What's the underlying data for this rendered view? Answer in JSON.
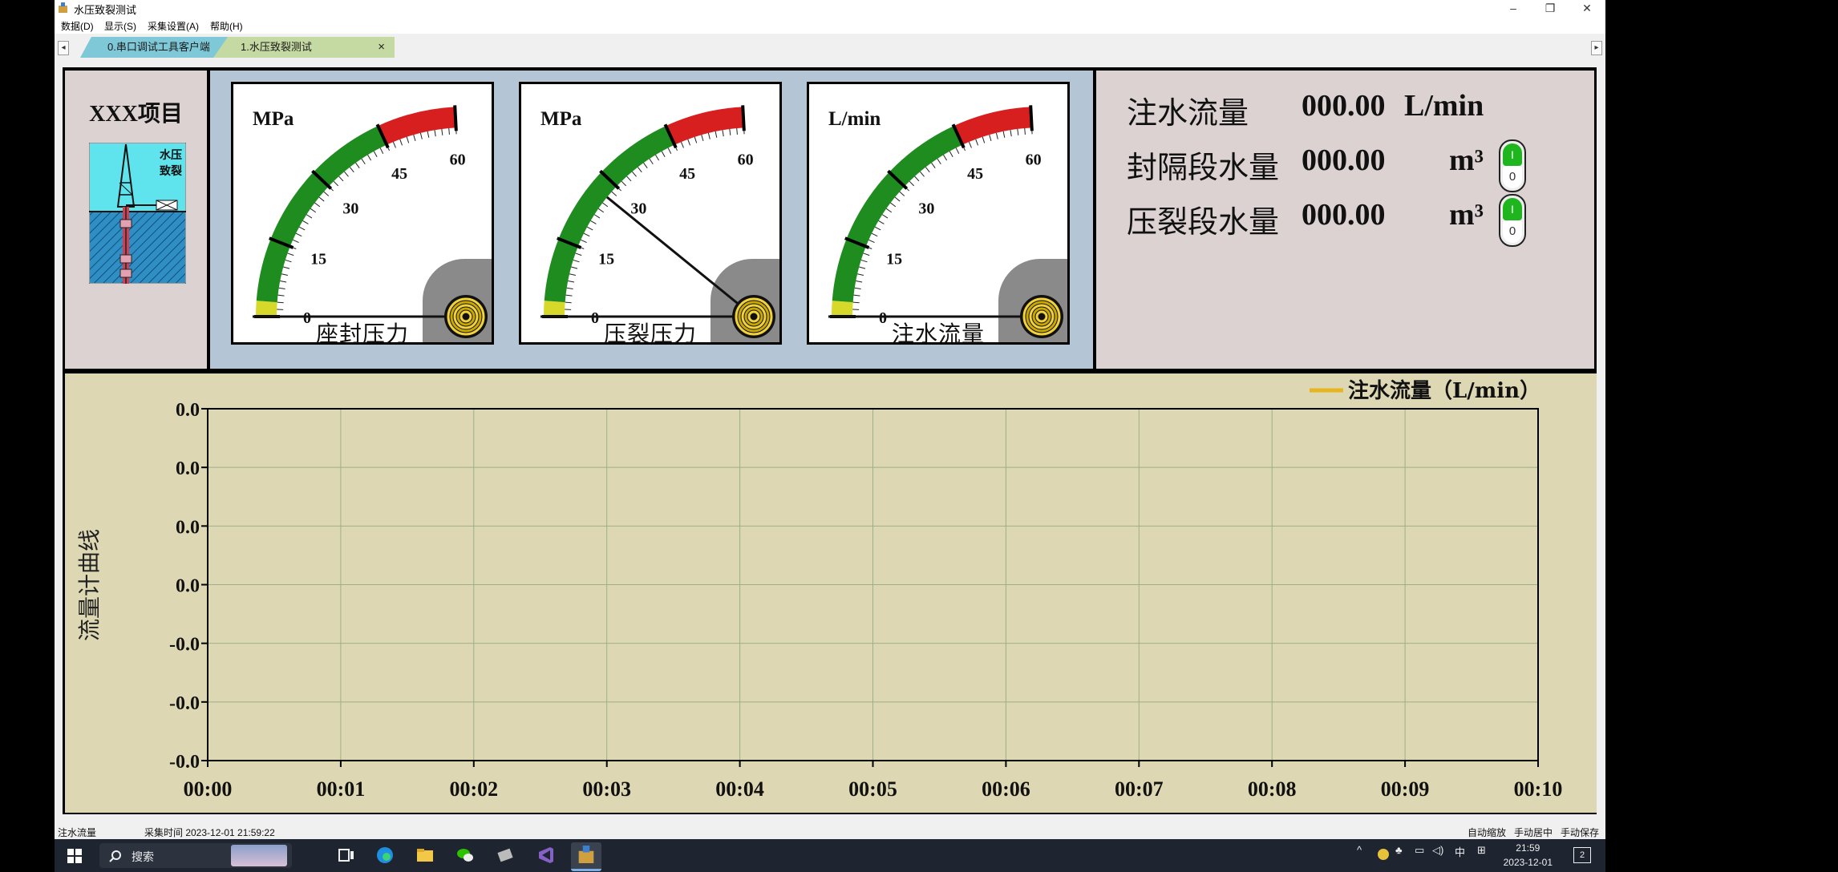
{
  "window": {
    "title": "水压致裂测试",
    "minimize": "–",
    "restore": "❐",
    "close": "✕"
  },
  "menu": [
    {
      "label": "数据(D)"
    },
    {
      "label": "显示(S)"
    },
    {
      "label": "采集设置(A)"
    },
    {
      "label": "帮助(H)"
    }
  ],
  "tabs": [
    {
      "label": "0.串口调试工具客户端"
    },
    {
      "label": "1.水压致裂测试",
      "close": "×"
    }
  ],
  "project": {
    "title": "XXX项目",
    "diagram_label_line1": "水压",
    "diagram_label_line2": "致裂"
  },
  "gauges": [
    {
      "unit": "MPa",
      "title": "座封压力",
      "value": 0,
      "max": 60,
      "ticks": [
        "0",
        "15",
        "30",
        "45",
        "60"
      ]
    },
    {
      "unit": "MPa",
      "title": "压裂压力",
      "value": 27,
      "max": 60,
      "ticks": [
        "0",
        "15",
        "30",
        "45",
        "60"
      ]
    },
    {
      "unit": "L/min",
      "title": "注水流量",
      "value": 0,
      "max": 60,
      "ticks": [
        "0",
        "15",
        "30",
        "45",
        "60"
      ]
    }
  ],
  "readouts": [
    {
      "label": "注水流量",
      "value": "000.00",
      "unit": "L/min"
    },
    {
      "label": "封隔段水量",
      "value": "000.00",
      "unit": "m³",
      "switch_on": "I",
      "switch_off": "0"
    },
    {
      "label": "压裂段水量",
      "value": "000.00",
      "unit": "m³",
      "switch_on": "I",
      "switch_off": "0"
    }
  ],
  "chart_data": {
    "type": "line",
    "title": "",
    "ylabel": "流量计曲线",
    "xlabel": "",
    "legend": "注水流量（L/min）",
    "legend_position": "top-right",
    "series_color": "#e8b520",
    "grid": true,
    "y_tick_labels": [
      "0.0",
      "0.0",
      "0.0",
      "0.0",
      "-0.0",
      "-0.0",
      "-0.0"
    ],
    "x_tick_labels": [
      "00:00",
      "00:01",
      "00:02",
      "00:03",
      "00:04",
      "00:05",
      "00:06",
      "00:07",
      "00:08",
      "00:09",
      "00:10"
    ],
    "series": [
      {
        "name": "注水流量（L/min）",
        "values": []
      }
    ]
  },
  "status": {
    "left": "注水流量",
    "time": "采集时间 2023-12-01 21:59:22",
    "auto_zoom": "自动缩放",
    "manual_pan": "手动居中",
    "manual_save": "手动保存"
  },
  "taskbar": {
    "search": "搜索",
    "ime": "中",
    "time": "21:59",
    "date": "2023-12-01",
    "notifications": "2"
  }
}
